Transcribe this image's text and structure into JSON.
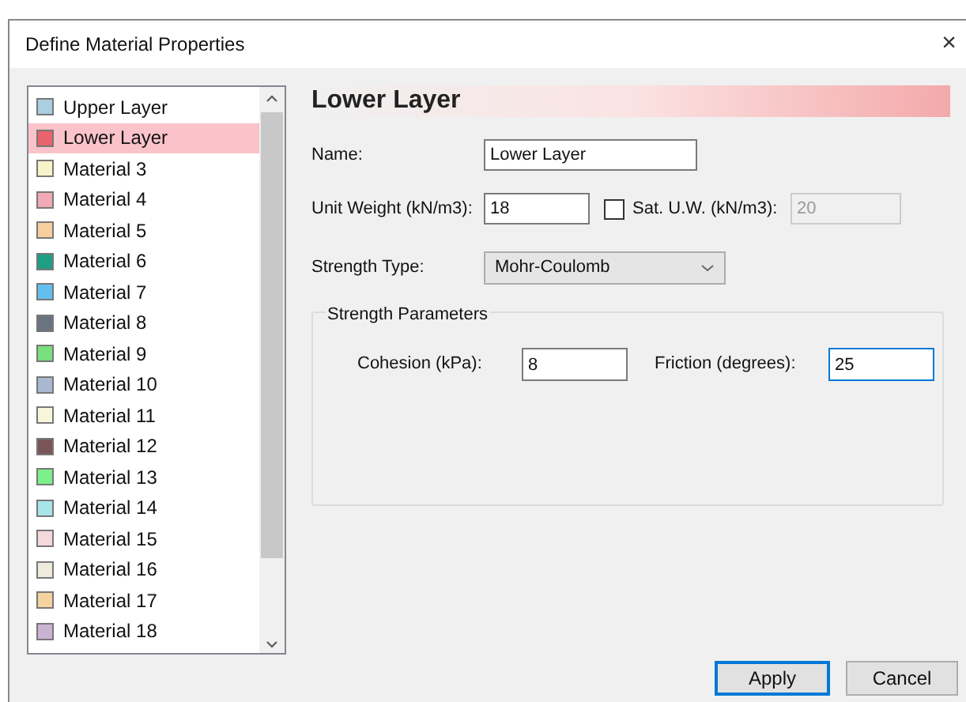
{
  "window": {
    "title": "Define Material Properties",
    "close": "×"
  },
  "materials": [
    {
      "label": "Upper Layer",
      "color": "#a9cfe0",
      "selected": false
    },
    {
      "label": "Lower Layer",
      "color": "#e8636b",
      "selected": true
    },
    {
      "label": "Material 3",
      "color": "#f6f3c8",
      "selected": false
    },
    {
      "label": "Material 4",
      "color": "#f2a9b5",
      "selected": false
    },
    {
      "label": "Material 5",
      "color": "#f6cf9e",
      "selected": false
    },
    {
      "label": "Material 6",
      "color": "#1f9e86",
      "selected": false
    },
    {
      "label": "Material 7",
      "color": "#63bfef",
      "selected": false
    },
    {
      "label": "Material 8",
      "color": "#6a7480",
      "selected": false
    },
    {
      "label": "Material 9",
      "color": "#78e07d",
      "selected": false
    },
    {
      "label": "Material 10",
      "color": "#a9b7d0",
      "selected": false
    },
    {
      "label": "Material 11",
      "color": "#f8f6da",
      "selected": false
    },
    {
      "label": "Material 12",
      "color": "#7a5658",
      "selected": false
    },
    {
      "label": "Material 13",
      "color": "#7ef08a",
      "selected": false
    },
    {
      "label": "Material 14",
      "color": "#a8e4e8",
      "selected": false
    },
    {
      "label": "Material 15",
      "color": "#f5d8dc",
      "selected": false
    },
    {
      "label": "Material 16",
      "color": "#eeeadc",
      "selected": false
    },
    {
      "label": "Material 17",
      "color": "#f4d3a0",
      "selected": false
    },
    {
      "label": "Material 18",
      "color": "#cbb3d3",
      "selected": false
    }
  ],
  "header": {
    "title": "Lower Layer"
  },
  "name": {
    "label": "Name:",
    "value": "Lower Layer"
  },
  "unit_weight": {
    "label": "Unit Weight (kN/m3):",
    "value": "18"
  },
  "sat_uw": {
    "label": "Sat. U.W. (kN/m3):",
    "checked": false,
    "value": "20",
    "disabled": true
  },
  "strength_type": {
    "label": "Strength Type:",
    "value": "Mohr-Coulomb"
  },
  "strength_parameters": {
    "title": "Strength Parameters",
    "fields": [
      {
        "label": "Cohesion (kPa):",
        "value": "8",
        "focused": false
      },
      {
        "label": "Friction (degrees):",
        "value": "25",
        "focused": true
      }
    ]
  },
  "buttons": [
    {
      "label": "Apply",
      "default": true
    },
    {
      "label": "Cancel",
      "default": false
    }
  ]
}
